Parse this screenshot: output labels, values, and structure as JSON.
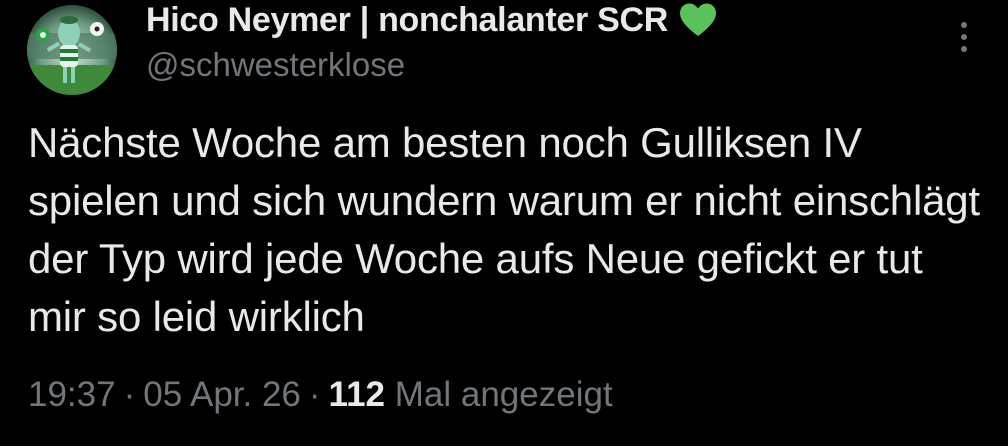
{
  "author": {
    "display_name": "Hico Neymer | nonchalanter SCR",
    "badge_icon": "green-heart-icon",
    "badge_color": "#5bc25b",
    "handle": "@schwesterklose",
    "avatar_icon": "squidward-soccer-avatar"
  },
  "tweet": {
    "text": "Nächste Woche am besten noch Gulliksen IV spielen und sich wundern warum er nicht einschlägt der Typ wird jede Woche aufs Neue gefickt er tut mir so leid wirklich",
    "time": "19:37",
    "separator": "·",
    "date": "05 Apr. 26",
    "views": "112",
    "views_label": "Mal angezeigt"
  },
  "actions": {
    "more_icon": "more-options-icon"
  },
  "colors": {
    "background": "#000000",
    "primary_text": "#e7e9ea",
    "secondary_text": "#71767b"
  }
}
